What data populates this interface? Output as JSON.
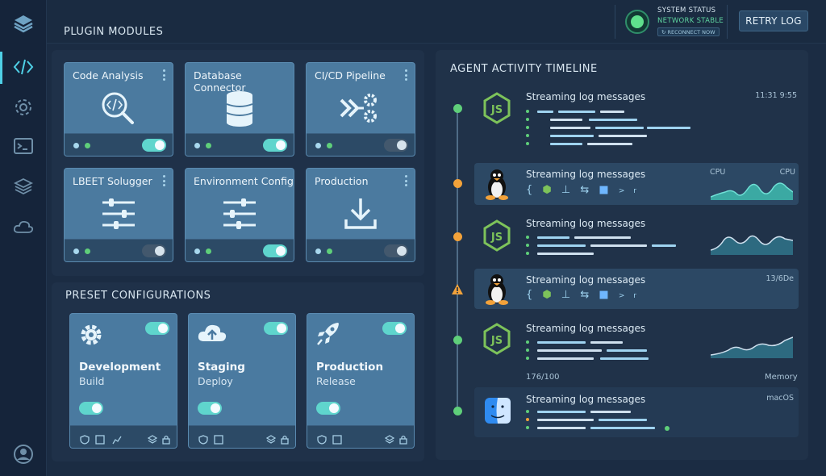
{
  "header": {
    "plugin_modules_title": "PLUGIN MODULES",
    "system_status_label": "SYSTEM STATUS",
    "network_status": "NETWORK STABLE",
    "reconnect_label": "RECONNECT NOW",
    "retry_label": "RETRY LOG"
  },
  "plugins": [
    {
      "title": "Code Analysis",
      "icon": "code-search-icon",
      "enabled": true
    },
    {
      "title": "Database Connector",
      "icon": "database-icon",
      "enabled": true
    },
    {
      "title": "CI/CD Pipeline",
      "icon": "pipeline-gears-icon",
      "enabled": false
    },
    {
      "title": "LBEET Solugger",
      "icon": "sliders-icon",
      "enabled": false
    },
    {
      "title": "Environment Config",
      "icon": "sliders-icon",
      "enabled": true
    },
    {
      "title": "Production",
      "icon": "download-icon",
      "enabled": false
    }
  ],
  "presets": {
    "title": "PRESET CONFIGURATIONS",
    "items": [
      {
        "name": "Development",
        "sub": "Build",
        "icon": "gear-icon",
        "enabled": true
      },
      {
        "name": "Staging",
        "sub": "Deploy",
        "icon": "cloud-upload-icon",
        "enabled": true
      },
      {
        "name": "Production",
        "sub": "Release",
        "icon": "rocket-icon",
        "enabled": true
      }
    ]
  },
  "timeline": {
    "title": "AGENT ACTIVITY TIMELINE",
    "entries": [
      {
        "message": "Streaming log messages",
        "source": "nodejs-icon",
        "status": "green",
        "right_label": "11:31 9:55"
      },
      {
        "message": "Streaming log messages",
        "source": "linux-icon",
        "status": "orange",
        "right_label_a": "CPU",
        "right_label_b": "CPU"
      },
      {
        "message": "Streaming log messages",
        "source": "nodejs-icon",
        "status": "orange"
      },
      {
        "message": "Streaming log messages",
        "source": "linux-icon",
        "status": "warning",
        "right_label": "13/6De"
      },
      {
        "message": "Streaming log messages",
        "source": "nodejs-icon",
        "status": "green"
      },
      {
        "message": "Streaming log messages",
        "source": "macos-finder-icon",
        "status": "green",
        "right_label": "macOS"
      }
    ],
    "memory_left": "176/100",
    "memory_right": "Memory"
  },
  "colors": {
    "accent": "#4fd0e6",
    "green": "#5fcf7a",
    "orange": "#f2a23a",
    "toggle_on": "#5fd5cd"
  }
}
